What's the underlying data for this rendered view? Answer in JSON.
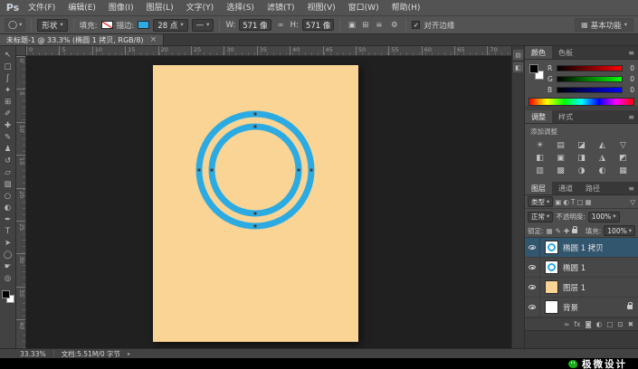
{
  "app": {
    "logo": "Ps"
  },
  "colors": {
    "doc": "#f9d495",
    "ring": "#2cabe2",
    "selection": "#33566f",
    "wechat_green": "#1aad19"
  },
  "icons": {
    "caret": "▾",
    "check": "✓",
    "gear": "⚙",
    "link": "∞",
    "funnel": "▽",
    "panel_menu": "≡",
    "status_caret": "▸",
    "tool_preset": "◯",
    "line_sample": "—"
  },
  "menu": {
    "items": [
      "文件(F)",
      "编辑(E)",
      "图像(I)",
      "图层(L)",
      "文字(Y)",
      "选择(S)",
      "滤镜(T)",
      "视图(V)",
      "窗口(W)",
      "帮助(H)"
    ]
  },
  "options": {
    "mode": "形状",
    "fill_label": "填充:",
    "stroke_label": "描边:",
    "stroke_width": "28 点",
    "w_label": "W:",
    "w_value": "571 像",
    "h_label": "H:",
    "h_value": "571 像",
    "path_ops": [
      "▣",
      "⊞",
      "≡"
    ],
    "align_edges_label": "对齐边缘",
    "workspace": "基本功能"
  },
  "tab": {
    "title": "未标题-1 @ 33.3% (椭圆 1 拷贝, RGB/8)",
    "close": "×"
  },
  "toolbar": {
    "tools": [
      {
        "id": "move-tool",
        "glyph": "↖"
      },
      {
        "id": "marquee-tool",
        "glyph": "□"
      },
      {
        "id": "lasso-tool",
        "glyph": "ʃ"
      },
      {
        "id": "quick-selection-tool",
        "glyph": "✦"
      },
      {
        "id": "crop-tool",
        "glyph": "⊞"
      },
      {
        "id": "eyedropper-tool",
        "glyph": "✐"
      },
      {
        "id": "healing-brush-tool",
        "glyph": "✚"
      },
      {
        "id": "brush-tool",
        "glyph": "✎"
      },
      {
        "id": "clone-stamp-tool",
        "glyph": "♟"
      },
      {
        "id": "history-brush-tool",
        "glyph": "↺"
      },
      {
        "id": "eraser-tool",
        "glyph": "▱"
      },
      {
        "id": "gradient-tool",
        "glyph": "▨"
      },
      {
        "id": "blur-tool",
        "glyph": "○"
      },
      {
        "id": "dodge-tool",
        "glyph": "◐"
      },
      {
        "id": "pen-tool",
        "glyph": "✒"
      },
      {
        "id": "type-tool",
        "glyph": "T"
      },
      {
        "id": "path-selection-tool",
        "glyph": "➤"
      },
      {
        "id": "ellipse-shape-tool",
        "glyph": "◯"
      },
      {
        "id": "hand-tool",
        "glyph": "☛"
      },
      {
        "id": "zoom-tool",
        "glyph": "◎"
      }
    ]
  },
  "ruler": {
    "top": [
      "0",
      "5",
      "10",
      "15",
      "20",
      "25",
      "30",
      "35",
      "40",
      "45",
      "50",
      "55",
      "60",
      "65",
      "70"
    ],
    "left": [
      "0",
      "5",
      "10",
      "15",
      "20",
      "25",
      "30",
      "35",
      "40"
    ]
  },
  "panels": {
    "color": {
      "tabs": [
        {
          "label": "颜色",
          "active": true
        },
        {
          "label": "色板"
        }
      ],
      "channels": [
        {
          "label": "R",
          "value": "0",
          "grad": "red"
        },
        {
          "label": "G",
          "value": "0",
          "grad": "green"
        },
        {
          "label": "B",
          "value": "0",
          "grad": "blue"
        }
      ]
    },
    "adjust": {
      "tabs": [
        {
          "label": "调整",
          "active": true
        },
        {
          "label": "样式"
        }
      ],
      "hint": "添加调整",
      "icons": [
        "☀",
        "▤",
        "◪",
        "◭",
        "▽",
        "◧",
        "▣",
        "◨",
        "◮",
        "◩",
        "▥",
        "▩",
        "◑",
        "◐",
        "▦"
      ]
    },
    "layers": {
      "tabs": [
        {
          "label": "图层",
          "active": true
        },
        {
          "label": "通道"
        },
        {
          "label": "路径"
        }
      ],
      "filter_label": "类型",
      "filter_icons": [
        "▣",
        "◐",
        "T",
        "□",
        "▦"
      ],
      "blend_mode": "正常",
      "opacity_label": "不透明度:",
      "opacity_value": "100%",
      "lock_label": "锁定:",
      "lock_icons": [
        "▦",
        "✎",
        "✚"
      ],
      "fill_label": "填充:",
      "fill_value": "100%",
      "rows": [
        {
          "name": "椭圆 1 拷贝",
          "thumb": "ellipse",
          "selected": true
        },
        {
          "name": "椭圆 1",
          "thumb": "ellipse"
        },
        {
          "name": "图层 1",
          "thumb": "peach"
        },
        {
          "name": "背景",
          "thumb": "white",
          "locked": true
        }
      ],
      "footer_icons": [
        "∞",
        "fx",
        "◙",
        "◐",
        "□",
        "⊡",
        "✖"
      ]
    }
  },
  "dock": {
    "icons": [
      "▤",
      "◧"
    ]
  },
  "status": {
    "zoom": "33.33%",
    "doc": "文档:5.51M/0 字节"
  },
  "footer": {
    "brand": "极微设计"
  }
}
